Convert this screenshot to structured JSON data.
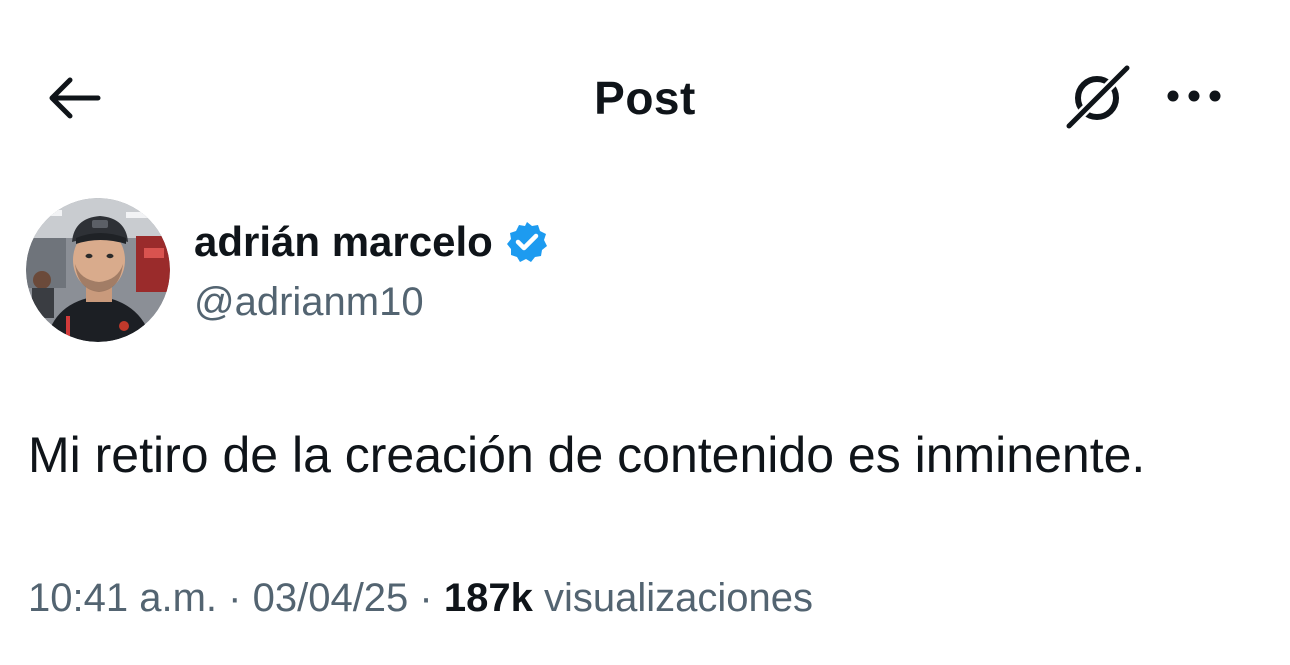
{
  "header": {
    "title": "Post",
    "back_icon": "arrow-left-icon",
    "grok_icon": "grok-icon",
    "more_icon": "more-horizontal-icon"
  },
  "author": {
    "name": "adrián marcelo",
    "handle": "@adrianm10",
    "verified": true,
    "verified_color": "#1d9bf0"
  },
  "post": {
    "text": "Mi retiro de la creación de contenido es inminente."
  },
  "meta": {
    "time": "10:41 a.m.",
    "separator": "·",
    "date": "03/04/25",
    "views_count": "187k",
    "views_label": "visualizaciones"
  },
  "colors": {
    "text_primary": "#0f1419",
    "text_secondary": "#536471",
    "background": "#ffffff"
  }
}
